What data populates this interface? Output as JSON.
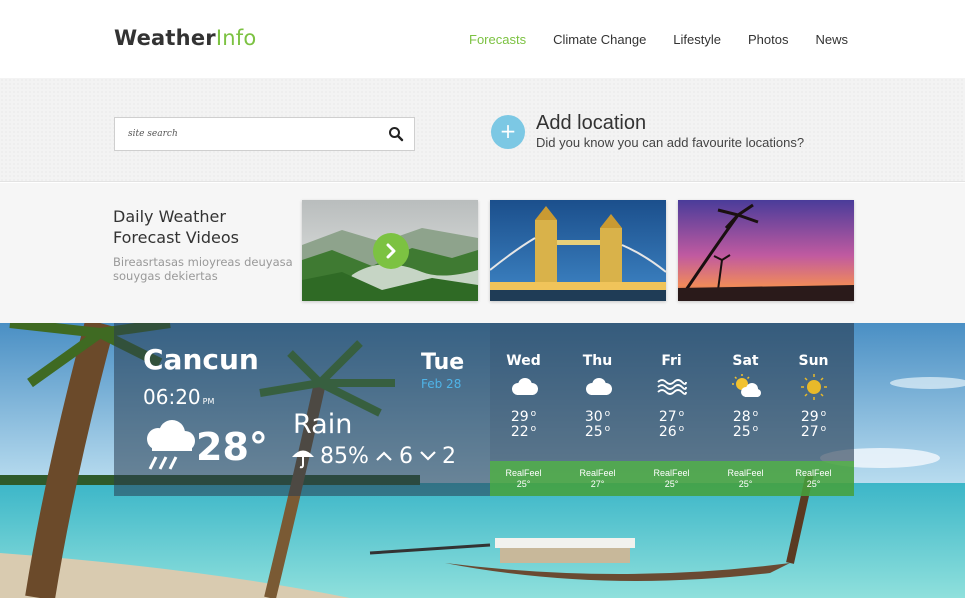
{
  "header": {
    "logo_main": "Weather",
    "logo_accent": "Info",
    "nav": [
      {
        "label": "Forecasts",
        "active": true
      },
      {
        "label": "Climate Change"
      },
      {
        "label": "Lifestyle"
      },
      {
        "label": "Photos"
      },
      {
        "label": "News"
      }
    ]
  },
  "search": {
    "placeholder": "site search",
    "icon": "search-icon"
  },
  "add_location": {
    "icon": "plus-icon",
    "title": "Add location",
    "subtitle": "Did you know you can add favourite locations?"
  },
  "videos": {
    "title": "Daily Weather Forecast Videos",
    "description": "Bireasrtasas mioyreas deuyasa souygas dekiertas",
    "thumbnails": [
      "misty-mountains",
      "tower-bridge-night",
      "palm-sunset"
    ],
    "play_icon": "play-icon"
  },
  "current": {
    "city": "Cancun",
    "time": "06:20",
    "ampm": "PM",
    "temp": "28°",
    "day": "Tue",
    "date": "Feb 28",
    "condition": "Rain",
    "humidity": "85%",
    "wind_high": "6",
    "wind_low": "2",
    "icon": "rain-cloud-icon"
  },
  "forecast": [
    {
      "day": "Wed",
      "hi": "29",
      "lo": "22",
      "icon": "cloud-icon",
      "realfeel_label": "RealFeel",
      "realfeel": "25°"
    },
    {
      "day": "Thu",
      "hi": "30",
      "lo": "25",
      "icon": "cloud-icon",
      "realfeel_label": "RealFeel",
      "realfeel": "27°"
    },
    {
      "day": "Fri",
      "hi": "27",
      "lo": "26",
      "icon": "fog-icon",
      "realfeel_label": "RealFeel",
      "realfeel": "25°"
    },
    {
      "day": "Sat",
      "hi": "28",
      "lo": "25",
      "icon": "partly-sunny-icon",
      "realfeel_label": "RealFeel",
      "realfeel": "25°"
    },
    {
      "day": "Sun",
      "hi": "29",
      "lo": "27",
      "icon": "sun-icon",
      "realfeel_label": "RealFeel",
      "realfeel": "25°"
    }
  ],
  "colors": {
    "accent": "#7cc242",
    "link_blue": "#4fb4e8",
    "add_button": "#7cc8e4"
  }
}
